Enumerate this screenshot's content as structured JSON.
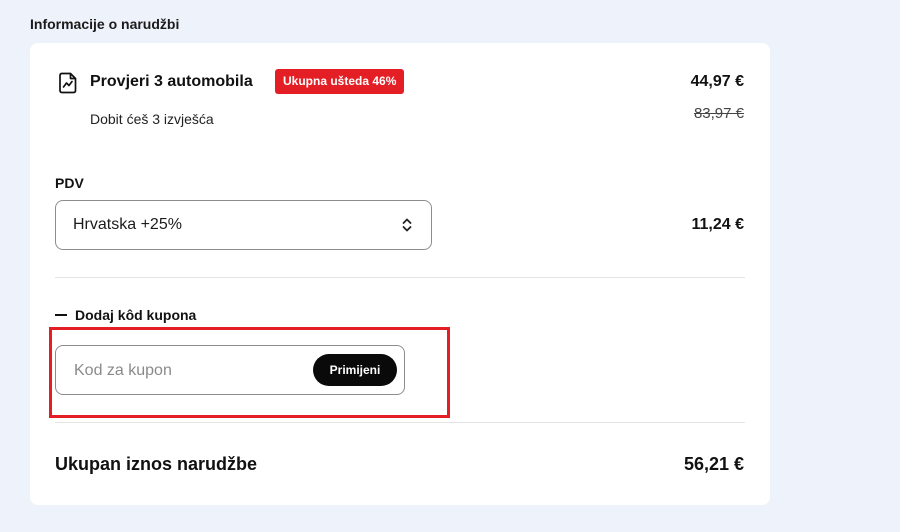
{
  "section": {
    "title": "Informacije o narudžbi"
  },
  "product": {
    "title": "Provjeri 3 automobila",
    "badge": "Ukupna ušteda 46%",
    "subtitle": "Dobit ćeš 3 izvješća",
    "price": "44,97 €",
    "old_price": "83,97 €",
    "icon": "report-document-icon"
  },
  "vat": {
    "label": "PDV",
    "selected": "Hrvatska +25%",
    "amount": "11,24 €",
    "icon": "select-chevron-updown-icon"
  },
  "coupon": {
    "toggle_label": "Dodaj kôd kupona",
    "placeholder": "Kod za kupon",
    "value": "",
    "apply_label": "Primijeni"
  },
  "total": {
    "label": "Ukupan iznos narudžbe",
    "amount": "56,21 €"
  },
  "colors": {
    "accent_red": "#e31e24",
    "background": "#eef2fa",
    "button_dark": "#0a0a0a"
  }
}
